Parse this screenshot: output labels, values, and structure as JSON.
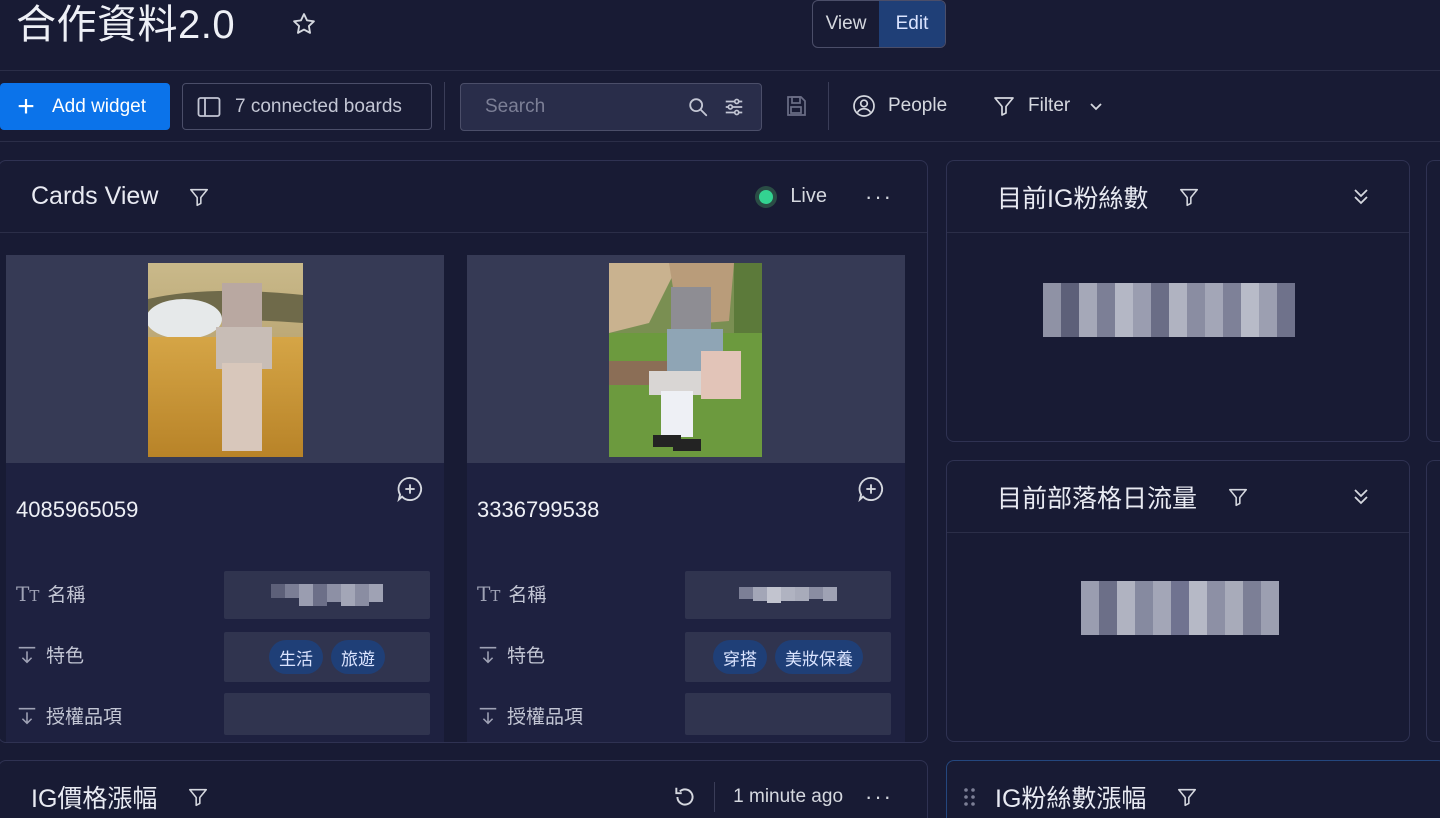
{
  "header": {
    "title": "合作資料2.0",
    "view_label": "View",
    "edit_label": "Edit"
  },
  "toolbar": {
    "add_widget_label": "Add widget",
    "connected_boards_label": "7 connected boards",
    "search_placeholder": "Search",
    "people_label": "People",
    "filter_label": "Filter"
  },
  "cards_view": {
    "title": "Cards View",
    "live_label": "Live",
    "live_color": "#33d391",
    "cards": [
      {
        "id": "4085965059",
        "fields": [
          {
            "label": "名稱",
            "icon": "text-type-icon"
          },
          {
            "label": "特色",
            "icon": "dropdown-column-icon",
            "tags": [
              "生活",
              "旅遊"
            ]
          },
          {
            "label": "授權品項",
            "icon": "dropdown-column-icon"
          }
        ]
      },
      {
        "id": "3336799538",
        "fields": [
          {
            "label": "名稱",
            "icon": "text-type-icon"
          },
          {
            "label": "特色",
            "icon": "dropdown-column-icon",
            "tags": [
              "穿搭",
              "美妝保養"
            ]
          },
          {
            "label": "授權品項",
            "icon": "dropdown-column-icon"
          }
        ]
      }
    ]
  },
  "ig_followers": {
    "title": "目前IG粉絲數"
  },
  "blog_traffic": {
    "title": "目前部落格日流量"
  },
  "ig_price": {
    "title": "IG價格漲幅",
    "updated_label": "1 minute ago"
  },
  "ig_followers_growth": {
    "title": "IG粉絲數漲幅"
  },
  "colors": {
    "background": "#181b34",
    "accent": "#0b73ea",
    "tag": "#1f3f77"
  }
}
